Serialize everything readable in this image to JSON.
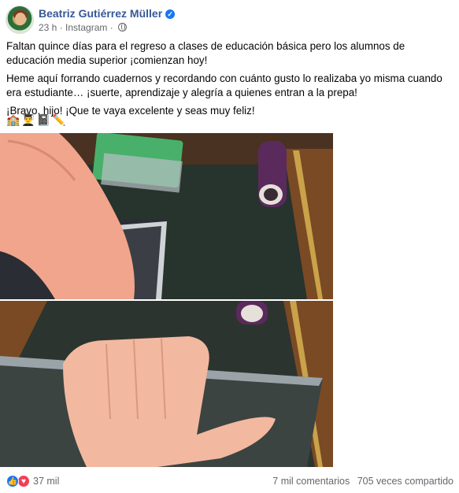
{
  "post": {
    "author": "Beatriz Gutiérrez Müller",
    "time": "23 h",
    "source": "Instagram",
    "paragraphs": [
      "Faltan quince días para el regreso a clases de educación básica pero los alumnos de educación media superior ¡comienzan hoy!",
      "Heme aquí forrando cuadernos y recordando con cuánto gusto lo realizaba yo misma cuando era estudiante… ¡suerte, aprendizaje y alegría a quienes entran a la prepa!",
      "¡Bravo, hijo! ¡Que te vaya excelente y seas muy feliz!"
    ],
    "emojis": "🏫👨‍🎓📓✏️"
  },
  "footer": {
    "reactions": "37 mil",
    "comments": "7 mil comentarios",
    "shares": "705 veces compartido"
  },
  "icons": {
    "verified": "verified-badge",
    "privacy": "globe-icon",
    "like": "like-reaction-icon",
    "love": "love-reaction-icon"
  },
  "colors": {
    "author": "#385898",
    "meta": "#65676b",
    "like": "#1877f2",
    "love": "#f33e58"
  }
}
